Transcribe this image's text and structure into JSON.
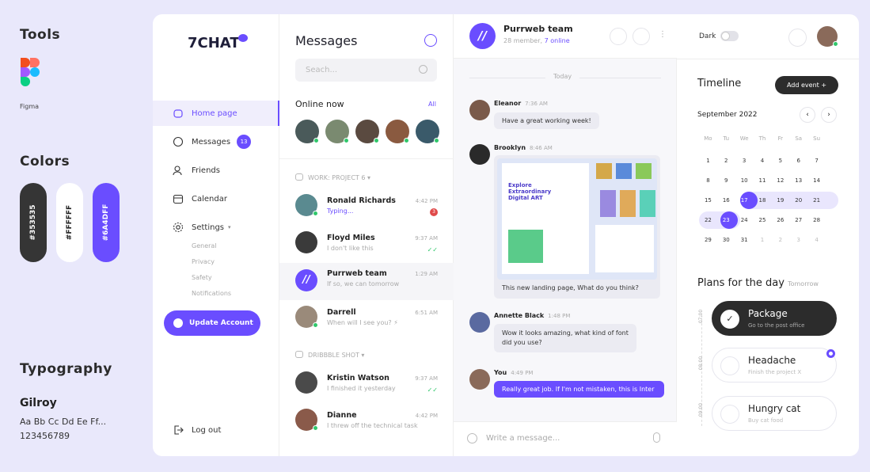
{
  "left": {
    "tools_title": "Tools",
    "figma_label": "Figma",
    "colors_title": "Colors",
    "colors": [
      "#353535",
      "#FFFFFF",
      "#6A4DFF"
    ],
    "typography_title": "Typography",
    "font_name": "Gilroy",
    "font_sample": "Aa Bb Cc Dd Ee Ff...",
    "font_numbers": "123456789"
  },
  "nav": {
    "logo_prefix": "7CHAT",
    "items": [
      {
        "label": "Home page"
      },
      {
        "label": "Messages",
        "badge": "13"
      },
      {
        "label": "Friends"
      },
      {
        "label": "Calendar"
      },
      {
        "label": "Settings"
      }
    ],
    "settings_sub": [
      "General",
      "Privacy",
      "Safety",
      "Notifications"
    ],
    "update": "Update Account",
    "logout": "Log out"
  },
  "messages": {
    "title": "Messages",
    "search_placeholder": "Seach...",
    "online_title": "Online now",
    "online_all": "All",
    "section1": "WORK: PROJECT 6",
    "section2": "DRIBBBLE SHOT",
    "chats": [
      {
        "name": "Ronald Richards",
        "msg": "Typing...",
        "time": "4:42 PM",
        "unread": "3"
      },
      {
        "name": "Floyd Miles",
        "msg": "I don't like this",
        "time": "9:37 AM"
      },
      {
        "name": "Purrweb team",
        "msg": "If so, we can tomorrow",
        "time": "1:29 AM"
      },
      {
        "name": "Darrell",
        "msg": "When will I see you? ⚡",
        "time": "6:51 AM"
      },
      {
        "name": "Kristin Watson",
        "msg": "I finished it yesterday",
        "time": "9:37 AM"
      },
      {
        "name": "Dianne",
        "msg": "I threw off the technical task",
        "time": "4:42 PM"
      }
    ]
  },
  "conversation": {
    "team": "Purrweb team",
    "members": "28 member,",
    "online": "7 online",
    "today": "Today",
    "m1_name": "Eleanor",
    "m1_time": "7:36 AM",
    "m1_text": "Have a great working week!",
    "m2_name": "Brooklyn",
    "m2_time": "8:46 AM",
    "m2_text": "This new landing page, What do you think?",
    "img_title": "Explore Extraordinary Digital ART",
    "m3_name": "Annette Black",
    "m3_time": "1:48 PM",
    "m3_text1": "Wow it looks amazing, what kind of font",
    "m3_text2": "did you use?",
    "m4_name": "You",
    "m4_time": "4:49 PM",
    "m4_text": "Really great job. If I'm not mistaken, this is Inter",
    "input_placeholder": "Write a message..."
  },
  "right": {
    "dark_label": "Dark",
    "timeline": "Timeline",
    "add_event": "Add event  +",
    "month": "September 2022",
    "weekdays": [
      "Mo",
      "Tu",
      "We",
      "Th",
      "Fr",
      "Sa",
      "Su"
    ],
    "weeks": [
      [
        "1",
        "2",
        "3",
        "4",
        "5",
        "6",
        "7"
      ],
      [
        "8",
        "9",
        "10",
        "11",
        "12",
        "13",
        "14"
      ],
      [
        "15",
        "16",
        "17",
        "18",
        "19",
        "20",
        "21"
      ],
      [
        "22",
        "23",
        "24",
        "25",
        "26",
        "27",
        "28"
      ],
      [
        "29",
        "30",
        "31",
        "1",
        "2",
        "3",
        "4"
      ]
    ],
    "plans_title": "Plans for the day",
    "plans_sub": "Tomorrow",
    "times": [
      "07:00",
      "08:00",
      "09:00"
    ],
    "plans": [
      {
        "title": "Package",
        "sub": "Go to the post office"
      },
      {
        "title": "Headache",
        "sub": "Finish the project X"
      },
      {
        "title": "Hungry cat",
        "sub": "Buy cat food"
      }
    ]
  },
  "colors": {
    "accent": "#6a4dff",
    "dark": "#353535",
    "green": "#30c76b"
  }
}
